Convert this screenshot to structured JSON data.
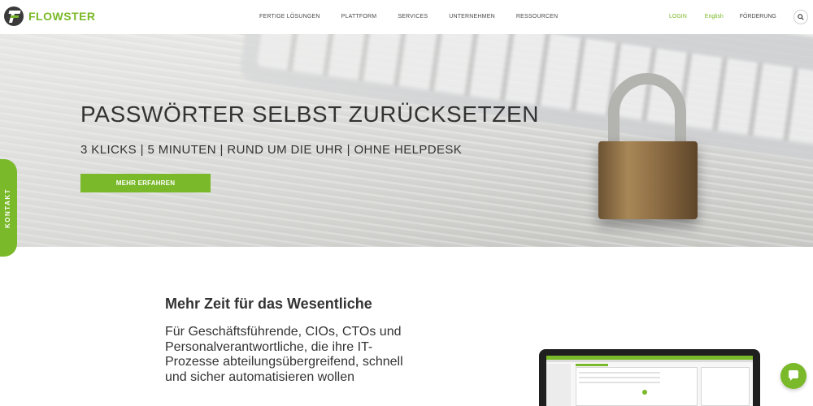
{
  "header": {
    "logo_text": "FLOWSTER",
    "nav": [
      "FERTIGE LÖSUNGEN",
      "PLATTFORM",
      "SERVICES",
      "UNTERNEHMEN",
      "RESSOURCEN"
    ],
    "login": "LOGIN",
    "language": "English",
    "support": "FÖRDERUNG",
    "search_icon": "search-icon"
  },
  "hero": {
    "title": "PASSWÖRTER SELBST ZURÜCKSETZEN",
    "subtitle": "3 KLICKS | 5 MINUTEN | RUND UM DIE UHR | OHNE HELPDESK",
    "button": "MEHR ERFAHREN",
    "contact_tab": "KONTAKT"
  },
  "content": {
    "title": "Mehr Zeit für das Wesentliche",
    "text": "Für Geschäftsführende, CIOs, CTOs und Personalverantwortliche, die ihre IT-Prozesse abteilungsübergreifend, schnell und sicher automatisieren wollen"
  },
  "colors": {
    "brand_green": "#7ab929",
    "text_dark": "#333333"
  },
  "chat_icon": "chat-icon"
}
